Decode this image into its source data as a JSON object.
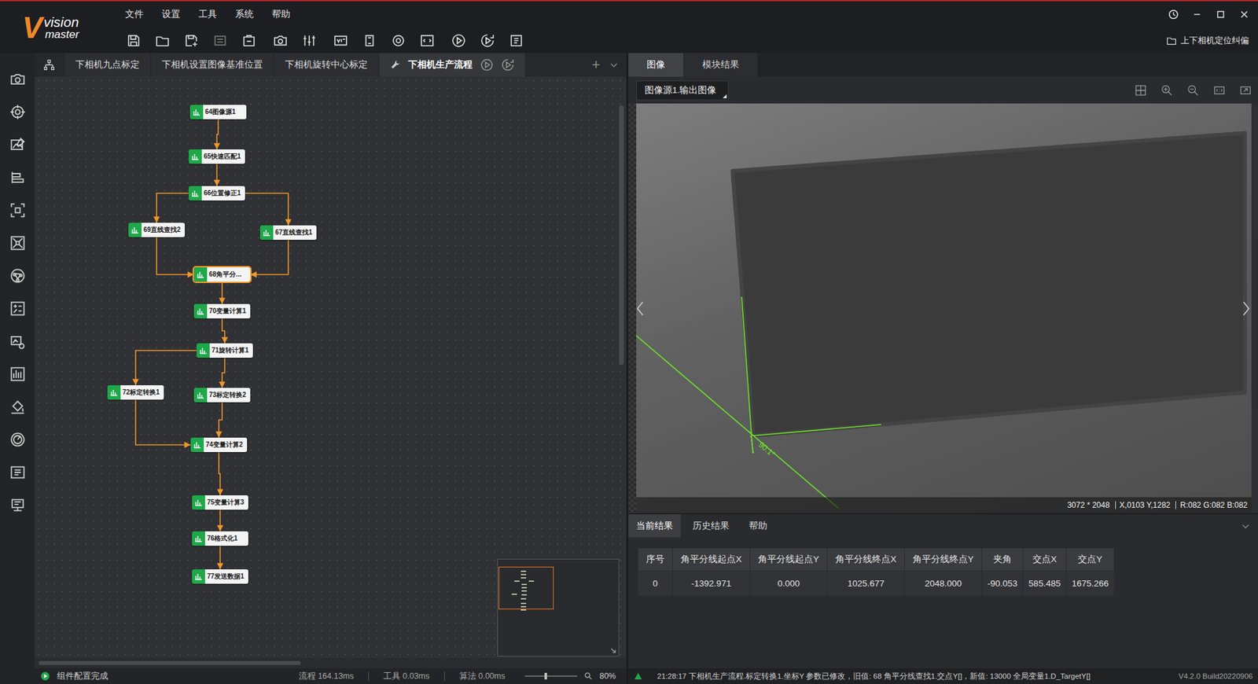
{
  "logo": {
    "mark": "V",
    "line1": "vision",
    "line2": "master"
  },
  "menu": [
    "文件",
    "设置",
    "工具",
    "系统",
    "帮助"
  ],
  "project": "上下相机定位纠偏",
  "flow_tabs": [
    {
      "label": "下相机九点标定",
      "selected": false
    },
    {
      "label": "下相机设置图像基准位置",
      "selected": false
    },
    {
      "label": "下相机旋转中心标定",
      "selected": false
    },
    {
      "label": "下相机生产流程",
      "selected": true
    }
  ],
  "flow_add": "+",
  "nodes": [
    {
      "label": "64图像源1",
      "selected": false
    },
    {
      "label": "65快速匹配1",
      "selected": false
    },
    {
      "label": "66位置修正1",
      "selected": false
    },
    {
      "label": "69直线查找2",
      "selected": false
    },
    {
      "label": "67直线查找1",
      "selected": false
    },
    {
      "label": "68角平分...",
      "selected": true
    },
    {
      "label": "70变量计算1",
      "selected": false
    },
    {
      "label": "71旋转计算1",
      "selected": false
    },
    {
      "label": "72标定转换1",
      "selected": false
    },
    {
      "label": "73标定转换2",
      "selected": false
    },
    {
      "label": "74变量计算2",
      "selected": false
    },
    {
      "label": "75变量计算3",
      "selected": false
    },
    {
      "label": "76格式化1",
      "selected": false
    },
    {
      "label": "77发送数据1",
      "selected": false
    }
  ],
  "edges": [
    [
      0,
      1
    ],
    [
      1,
      2
    ],
    [
      2,
      3
    ],
    [
      2,
      4
    ],
    [
      3,
      5
    ],
    [
      4,
      5
    ],
    [
      5,
      6
    ],
    [
      6,
      7
    ],
    [
      7,
      8
    ],
    [
      7,
      9
    ],
    [
      8,
      10
    ],
    [
      9,
      10
    ],
    [
      10,
      11
    ],
    [
      11,
      12
    ],
    [
      12,
      13
    ]
  ],
  "flow_status": {
    "message": "组件配置完成",
    "process": "流程 164.13ms",
    "tool": "工具 0.03ms",
    "algorithm": "算法 0.00ms",
    "zoom": {
      "level": 0.4,
      "reading": "80%"
    }
  },
  "view_tabs": [
    {
      "label": "图像",
      "selected": true
    },
    {
      "label": "模块结果",
      "selected": false
    }
  ],
  "image_source": "图像源1.输出图像",
  "image": {
    "angle_label": "90.1°",
    "size": "3072 * 2048",
    "cursor": "X,0103 Y,1282",
    "rgb": "R:082 G:082 B:082"
  },
  "result_tabs": [
    {
      "label": "当前结果",
      "selected": true
    },
    {
      "label": "历史结果",
      "selected": false
    },
    {
      "label": "帮助",
      "selected": false
    }
  ],
  "table": {
    "columns": [
      "序号",
      "角平分线起点X",
      "角平分线起点Y",
      "角平分线终点X",
      "角平分线终点Y",
      "夹角",
      "交点X",
      "交点Y"
    ],
    "rows": [
      [
        "0",
        "-1392.971",
        "0.000",
        "1025.677",
        "2048.000",
        "-90.053",
        "585.485",
        "1675.266"
      ]
    ]
  },
  "log": {
    "message": "21:28:17 下相机生产流程.标定转换1.坐标Y 参数已修改，旧值: 68 角平分线查找1.交点Y[]，新值: 13000 全局变量1.D_TargetY[]",
    "version": "V4.2.0 Build20220906"
  }
}
